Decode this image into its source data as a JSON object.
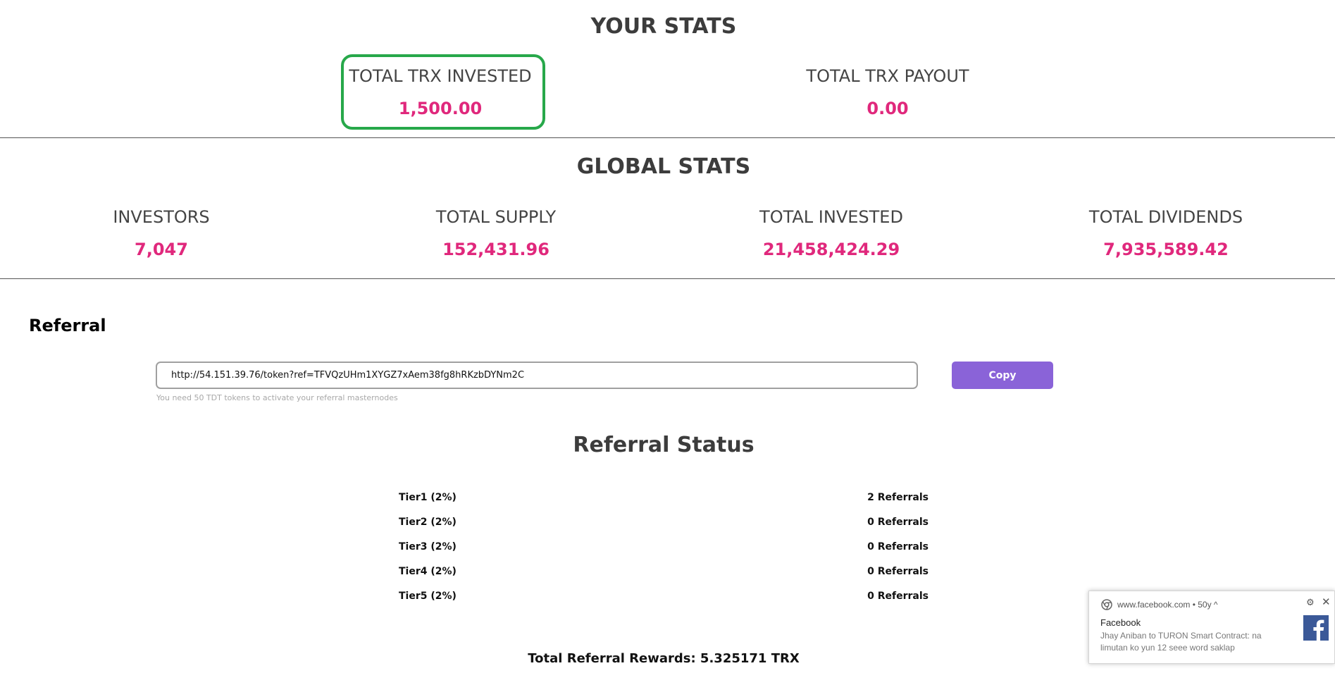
{
  "your_stats": {
    "title": "YOUR STATS",
    "items": [
      {
        "label": "TOTAL TRX INVESTED",
        "value": "1,500.00"
      },
      {
        "label": "TOTAL TRX PAYOUT",
        "value": "0.00"
      }
    ]
  },
  "global_stats": {
    "title": "GLOBAL STATS",
    "items": [
      {
        "label": "INVESTORS",
        "value": "7,047"
      },
      {
        "label": "TOTAL SUPPLY",
        "value": "152,431.96"
      },
      {
        "label": "TOTAL INVESTED",
        "value": "21,458,424.29"
      },
      {
        "label": "TOTAL DIVIDENDS",
        "value": "7,935,589.42"
      }
    ]
  },
  "referral": {
    "heading": "Referral",
    "link_value": "http://54.151.39.76/token?ref=TFVQzUHm1XYGZ7xAem38fg8hRKzbDYNm2C",
    "hint": "You need 50 TDT tokens to activate your referral masternodes",
    "copy_label": "Copy"
  },
  "referral_status": {
    "title": "Referral Status",
    "tiers": [
      {
        "name": "Tier1 (2%)",
        "count": "2 Referrals"
      },
      {
        "name": "Tier2 (2%)",
        "count": "0 Referrals"
      },
      {
        "name": "Tier3 (2%)",
        "count": "0 Referrals"
      },
      {
        "name": "Tier4 (2%)",
        "count": "0 Referrals"
      },
      {
        "name": "Tier5 (2%)",
        "count": "0 Referrals"
      }
    ],
    "total_rewards": "Total Referral Rewards: 5.325171 TRX"
  },
  "notification": {
    "source": "www.facebook.com • 50у ^",
    "title": "Facebook",
    "body": "Jhay Aniban to TURON Smart Contract: na limutan ko yun 12 seee word saklap",
    "icons": {
      "app": "chrome-icon",
      "brand": "facebook-icon",
      "settings": "gear-icon",
      "close": "close-icon"
    }
  },
  "colors": {
    "accent_value": "#e0287c",
    "highlight_border": "#27a84a",
    "copy_button": "#8a63d8"
  }
}
